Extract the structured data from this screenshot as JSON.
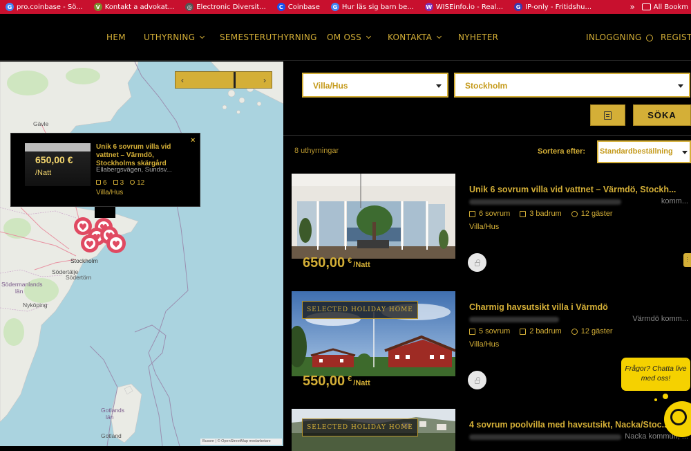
{
  "bookmarks": [
    {
      "label": "pro.coinbase - Sö...",
      "icon": "google-icon",
      "color": "#4285f4",
      "glyph": "G"
    },
    {
      "label": "Kontakt a advokat...",
      "icon": "v-icon",
      "color": "#7a8c2e",
      "glyph": "V"
    },
    {
      "label": "Electronic Diversit...",
      "icon": "globe-icon",
      "color": "#555555",
      "glyph": "◎"
    },
    {
      "label": "Coinbase",
      "icon": "coinbase-icon",
      "color": "#1652f0",
      "glyph": "C"
    },
    {
      "label": "Hur läs sig barn be...",
      "icon": "google-icon",
      "color": "#4285f4",
      "glyph": "G"
    },
    {
      "label": "WISEinfo.io - Real...",
      "icon": "wise-icon",
      "color": "#7b2fb8",
      "glyph": "W"
    },
    {
      "label": "IP-only - Fritidshu...",
      "icon": "g-icon",
      "color": "#3a3ab0",
      "glyph": "G"
    }
  ],
  "bookmarks_more": "»",
  "bookmarks_folder": "All Bookm",
  "nav": {
    "items": [
      "HEM",
      "UTHYRNING",
      "SEMESTERUTHYRNING",
      "OM OSS",
      "KONTAKTA",
      "NYHETER"
    ],
    "login": "INLOGGNING",
    "register": "REGISTE"
  },
  "map": {
    "labels": {
      "gavle": "Gävle",
      "stockholm": "Stockholm",
      "sodertalje": "Södertälje",
      "sodertorn": "Södertörn",
      "sodermanlands": "Södermanlands",
      "lan": "län",
      "nykoping": "Nyköping",
      "gotlands": "Gotlands",
      "lan2": "län",
      "gotland": "Gotland"
    },
    "slider_prev": "‹",
    "slider_next": "›",
    "attribution": "Bussnr | © OpenStreetMap medarbetare",
    "popup": {
      "price": "650,00 €",
      "unit": "/Natt",
      "title": "Unik 6 sovrum villa vid vattnet – Värmdö, Stockholms skärgård",
      "address": "Ellabergsvägen, Sundsv...",
      "bedrooms": "6",
      "bathrooms": "3",
      "guests": "12",
      "type": "Villa/Hus",
      "close": "×"
    }
  },
  "filters": {
    "type": "Villa/Hus",
    "location": "Stockholm",
    "search": "SÖKA"
  },
  "results": {
    "count": "8 uthyrningar",
    "sort_label": "Sortera efter:",
    "sort_value": "Standardbeställning"
  },
  "listings": [
    {
      "title": "Unik 6 sovrum villa vid vattnet – Värmdö, Stockh...",
      "address": "komm...",
      "bedrooms": "6 sovrum",
      "bathrooms": "3 badrum",
      "guests": "12 gäster",
      "type": "Villa/Hus",
      "price": "650,00",
      "currency": "€",
      "unit": "/Natt",
      "badge": ""
    },
    {
      "title": "Charmig havsutsikt villa i Värmdö",
      "address": "Värmdö komm...",
      "bedrooms": "5 sovrum",
      "bathrooms": "2 badrum",
      "guests": "12 gäster",
      "type": "Villa/Hus",
      "price": "550,00",
      "currency": "€",
      "unit": "/Natt",
      "badge": "SELECTED HOLIDAY HOME"
    },
    {
      "title": "4 sovrum poolvilla med havsutsikt, Nacka/Stoc...",
      "address": "Nacka kommun, ...",
      "badge": "SELECTED HOLIDAY HOME"
    }
  ],
  "chat": {
    "bubble": "Frågor? Chatta live med oss!"
  }
}
